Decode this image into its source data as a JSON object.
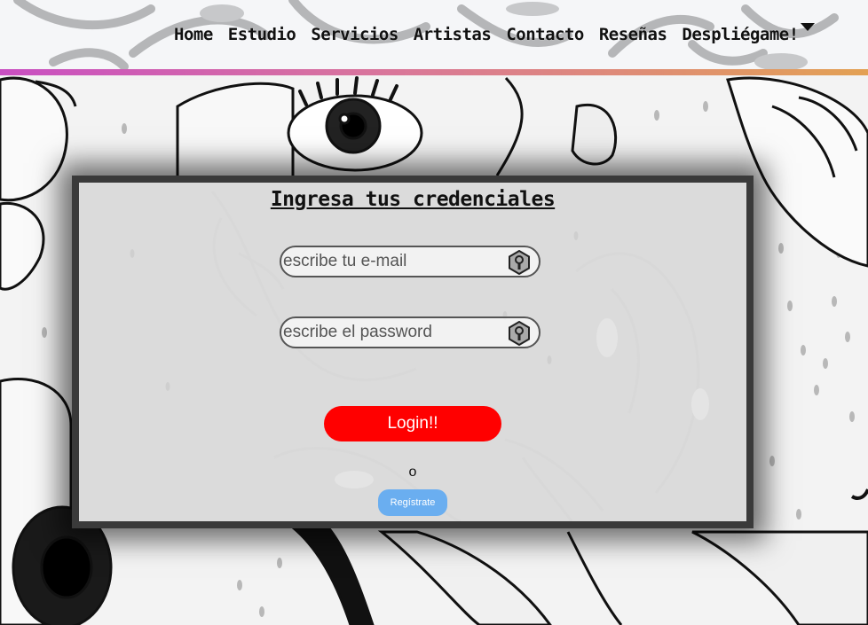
{
  "navbar": {
    "links": [
      "Home",
      "Estudio",
      "Servicios",
      "Artistas",
      "Contacto",
      "Reseñas"
    ],
    "dropdown_label": "Despliégame!",
    "gradient_colors": [
      "#c94fc2",
      "#d9769a",
      "#e3a153"
    ]
  },
  "login": {
    "title": "Ingresa tus credenciales",
    "email_placeholder": "escribe tu e-mail",
    "password_placeholder": "escribe el password",
    "login_label": "Login!!",
    "or_text": "o",
    "register_label": "Regístrate",
    "field_icon": "key-hole-icon"
  },
  "colors": {
    "login_button": "#ff0000",
    "register_button": "#6aaef0",
    "card_frame": "#3a3a3a"
  }
}
